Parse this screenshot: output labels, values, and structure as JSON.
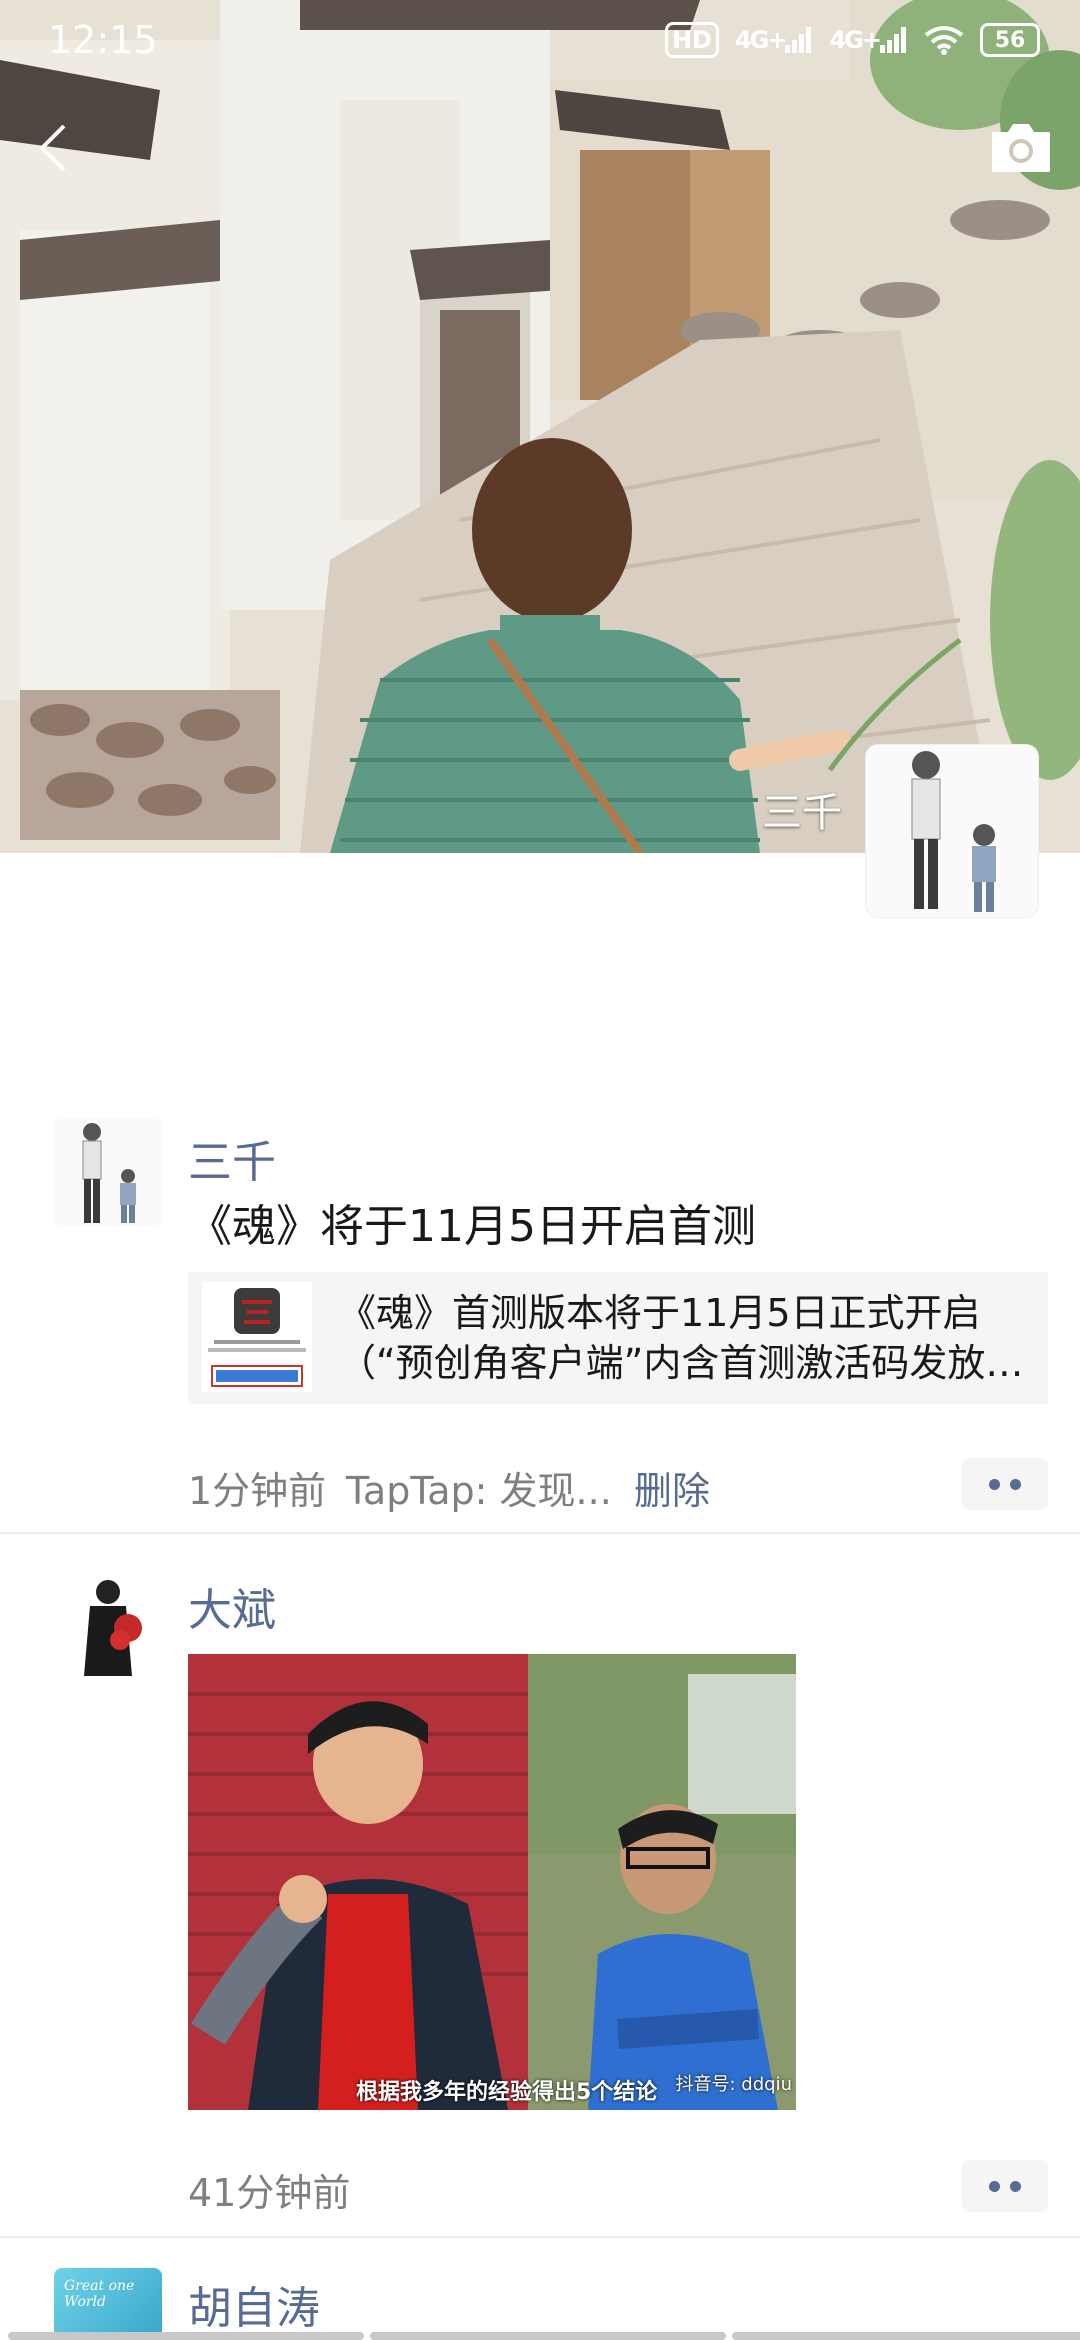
{
  "status": {
    "time": "12:15",
    "hd": "HD",
    "net1": "4G+",
    "net2": "4G+",
    "battery": "56"
  },
  "header": {
    "back_icon": "chevron-left-icon",
    "camera_icon": "camera-icon",
    "cover_name": "三千"
  },
  "posts": [
    {
      "nickname": "三千",
      "text": "《魂》将于11月5日开启首测",
      "link": {
        "title": "《魂》首测版本将于11月5日正式开启",
        "subtitle": "（“预创角客户端”内含首测激活码发放…"
      },
      "time": "1分钟前",
      "source": "TapTap: 发现...",
      "delete": "删除"
    },
    {
      "nickname": "大斌",
      "image_caption": "根据我多年的经验得出5个结论",
      "image_watermark": "抖音号: ddqiu",
      "time": "41分钟前"
    },
    {
      "nickname": "胡自涛",
      "avatar_text": "Great one World"
    }
  ],
  "colors": {
    "link_blue": "#576b95",
    "meta_gray": "#7f7f7f",
    "card_bg": "#f5f5f5"
  }
}
